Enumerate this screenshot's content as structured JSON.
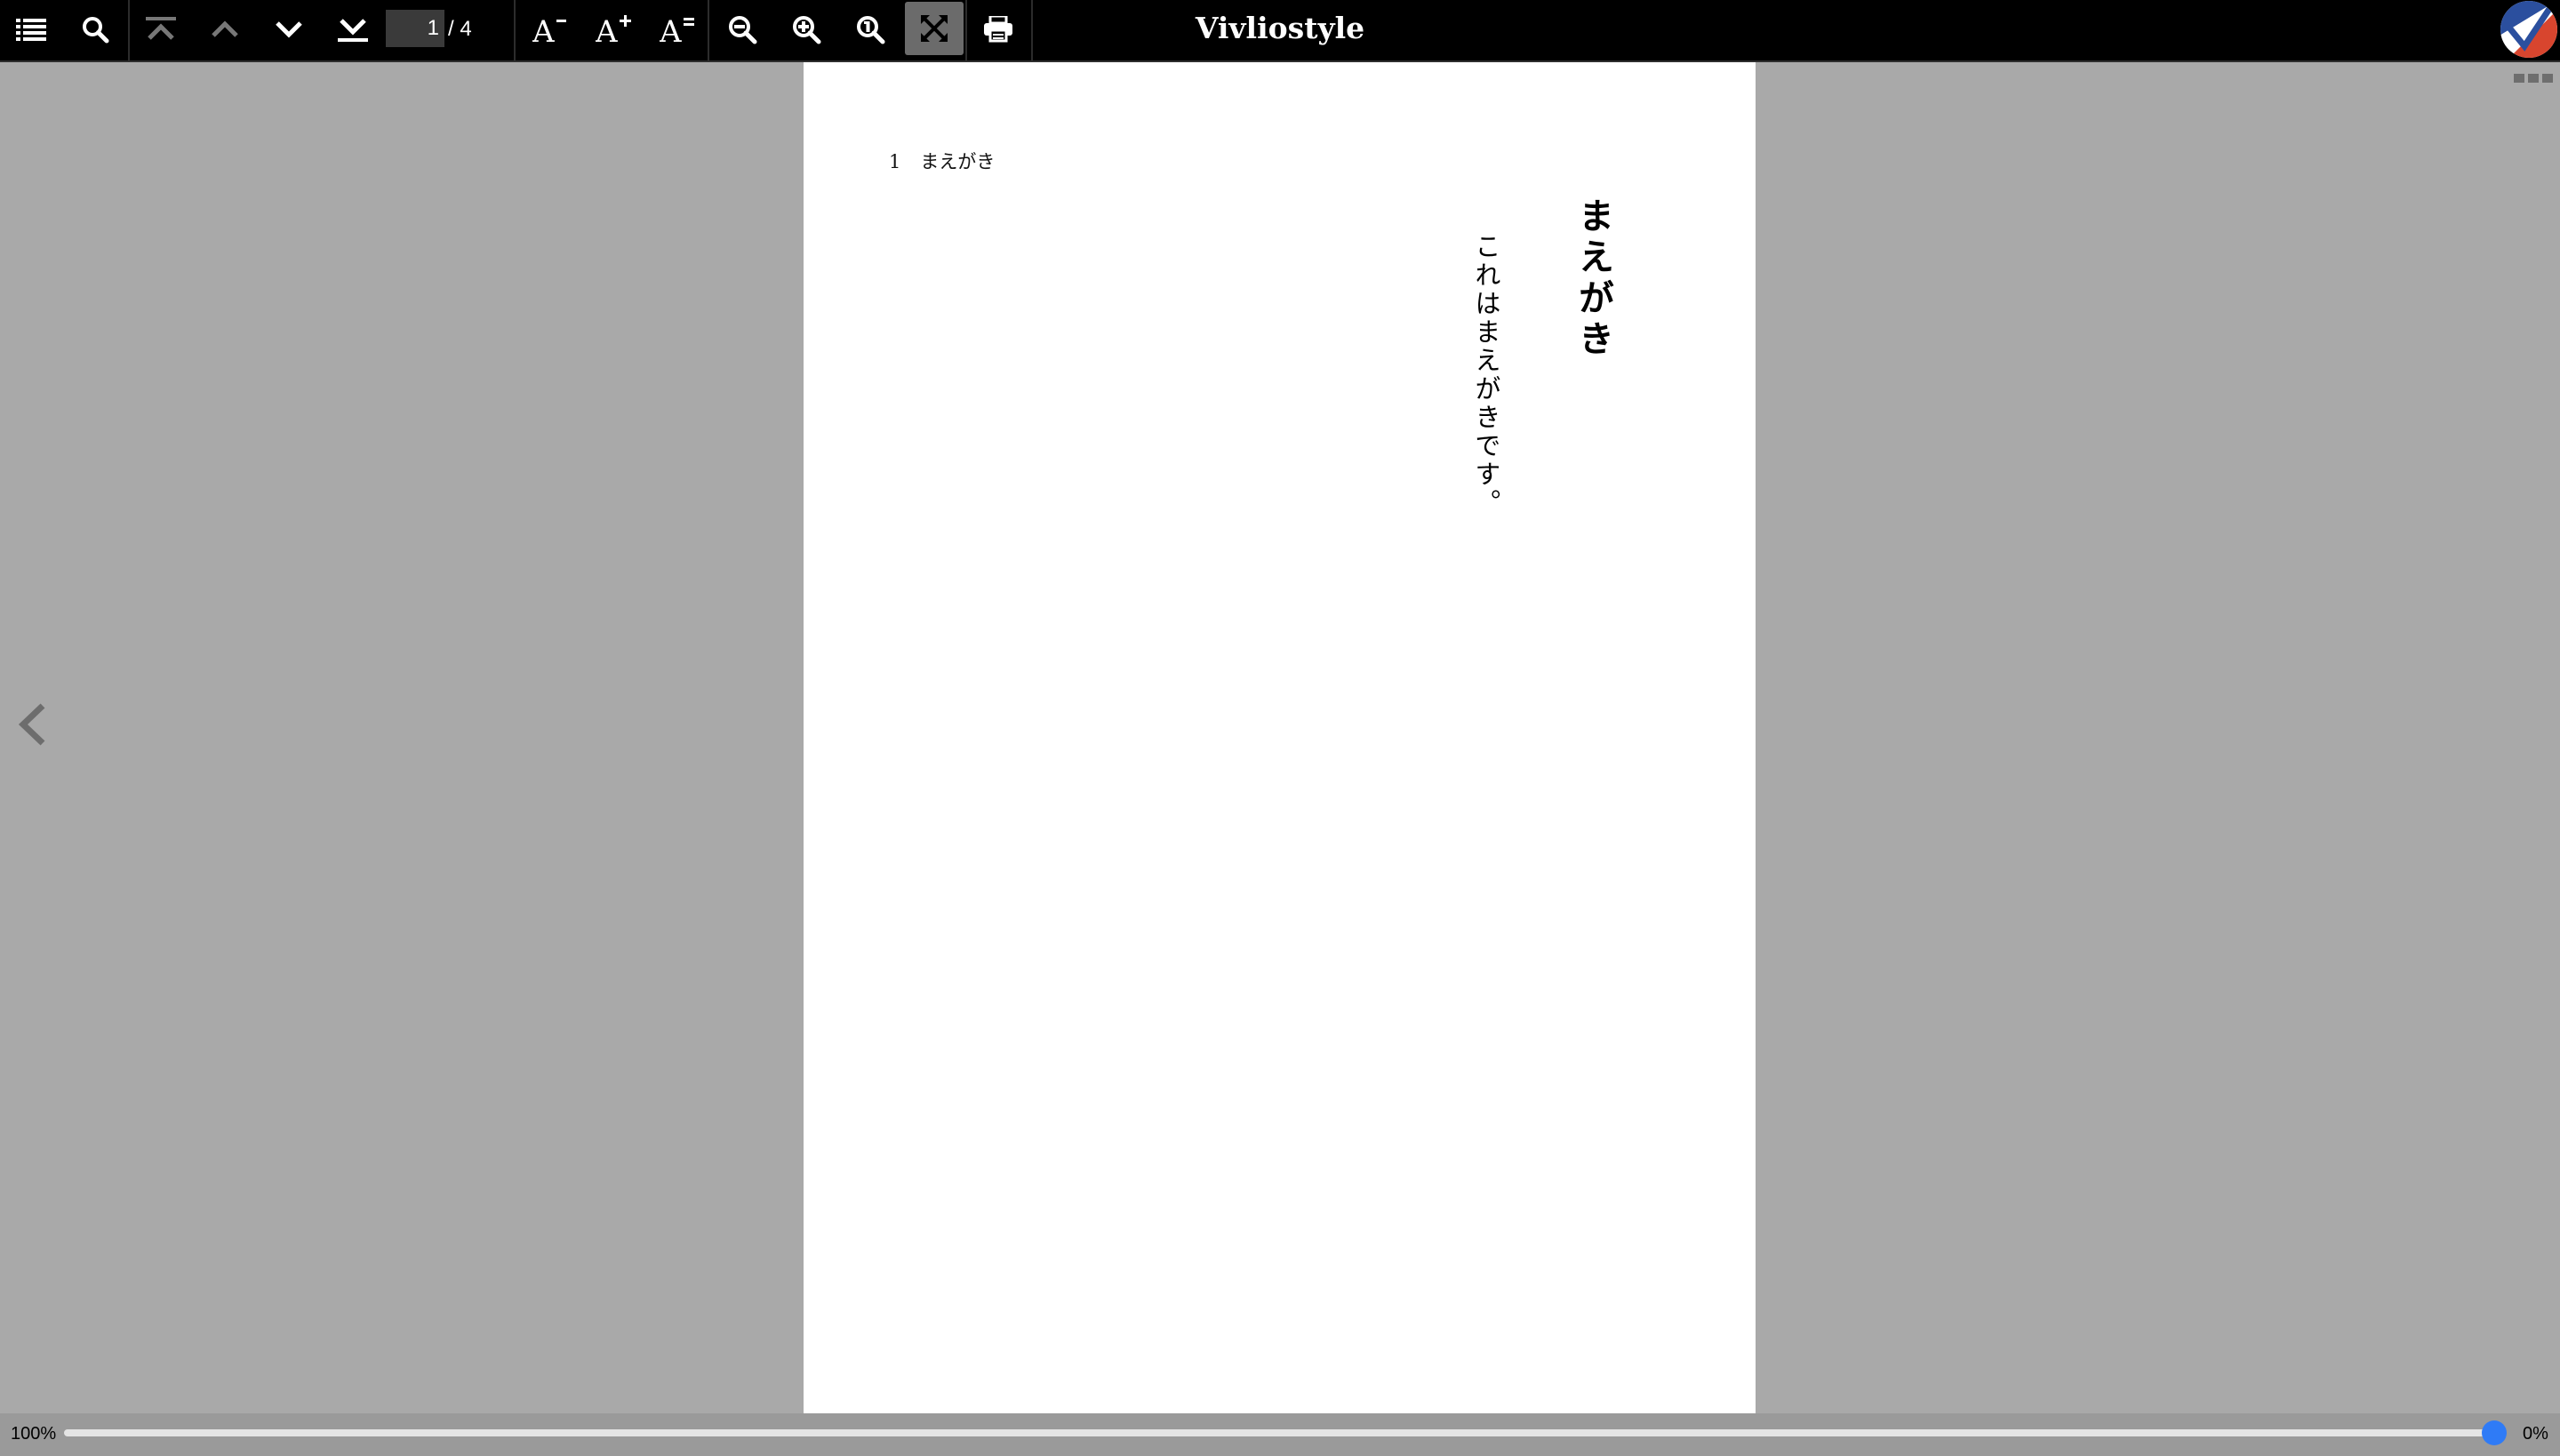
{
  "app": {
    "title": "Vivliostyle"
  },
  "toolbar": {
    "toc_icon": "list-icon",
    "search_icon": "search-icon",
    "first_page_icon": "first-page-icon",
    "prev_page_icon": "chevron-up-icon",
    "next_page_icon": "chevron-down-icon",
    "last_page_icon": "last-page-icon",
    "page_number": "1",
    "page_total": "/ 4",
    "font_smaller_icon": "font-smaller-icon",
    "font_larger_icon": "font-larger-icon",
    "font_reset_icon": "font-reset-icon",
    "zoom_out_icon": "zoom-out-icon",
    "zoom_in_icon": "zoom-in-icon",
    "zoom_actual_icon": "zoom-actual-icon",
    "fit_to_screen_icon": "fit-to-screen-icon",
    "print_icon": "print-icon",
    "fit_to_screen_active": true
  },
  "page": {
    "running_head_number": "1",
    "running_head_title": "まえがき",
    "chapter_title": "まえがき",
    "body": "これはまえがきです。"
  },
  "navigation": {
    "prev_icon": "chevron-left-icon"
  },
  "progress": {
    "zoom": "100%",
    "percent_label": "0%",
    "value": 0
  },
  "colors": {
    "toolbar_bg": "#000000",
    "viewer_bg": "#a9a9a9",
    "accent": "#2f7bf6"
  }
}
